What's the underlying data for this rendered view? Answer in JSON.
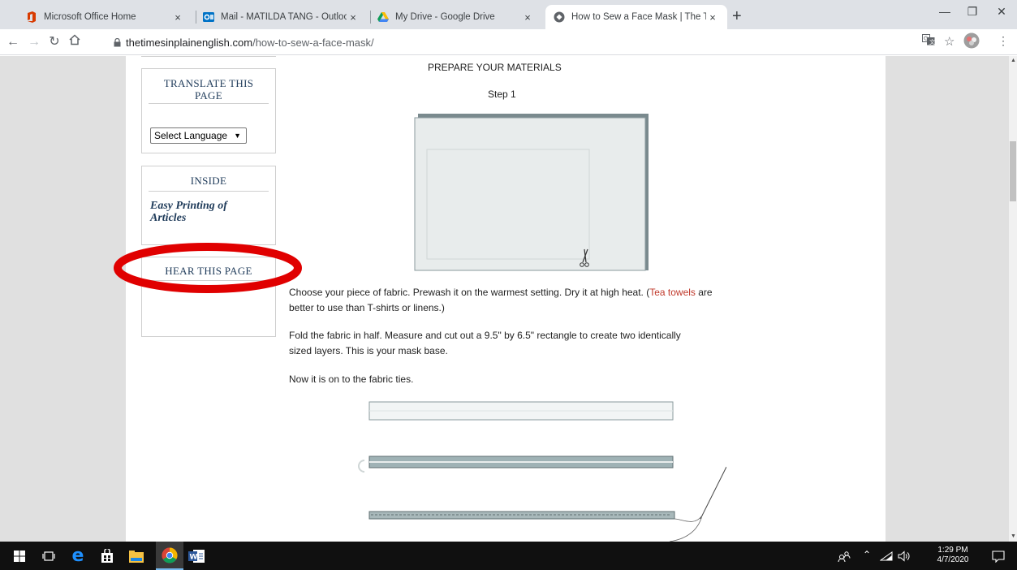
{
  "browser": {
    "tabs": [
      {
        "title": "Microsoft Office Home",
        "favicon": "office-icon",
        "active": false
      },
      {
        "title": "Mail - MATILDA TANG - Outlook",
        "favicon": "outlook-icon",
        "active": false
      },
      {
        "title": "My Drive - Google Drive",
        "favicon": "google-drive-icon",
        "active": false
      },
      {
        "title": "How to Sew a Face Mask | The Ti",
        "favicon": "page-icon",
        "active": true
      }
    ],
    "close_glyph": "×",
    "new_tab_glyph": "+",
    "url_host": "thetimesinplainenglish.com",
    "url_path": "/how-to-sew-a-face-mask/"
  },
  "sidebar": {
    "translate": {
      "title_line1": "TRANSLATE THIS",
      "title_line2": "PAGE",
      "select_value": "Select Language",
      "select_arrow": "▼"
    },
    "inside": {
      "title": "INSIDE",
      "link_line1": "Easy Printing of",
      "link_line2": "Articles"
    },
    "hear": {
      "title": "HEAR THIS PAGE",
      "annotation_color": "#e00000"
    }
  },
  "article": {
    "heading": "PREPARE YOUR MATERIALS",
    "step": "Step 1",
    "para1_a": "Choose your piece of fabric. Prewash it on the warmest setting. Dry it at high heat. (",
    "para1_link": "Tea towels",
    "para1_b": " are better to use than T-shirts or linens.)",
    "para2": "Fold the fabric in half. Measure and cut out a 9.5\" by 6.5\" rectangle to create two identically sized layers. This is your mask base.",
    "para3": "Now it is on to the fabric ties."
  },
  "taskbar": {
    "time": "1:29 PM",
    "date": "4/7/2020"
  },
  "colors": {
    "link_red": "#c0392b",
    "sidebar_title": "#1f3b5a",
    "annotation_red": "#e00000"
  }
}
